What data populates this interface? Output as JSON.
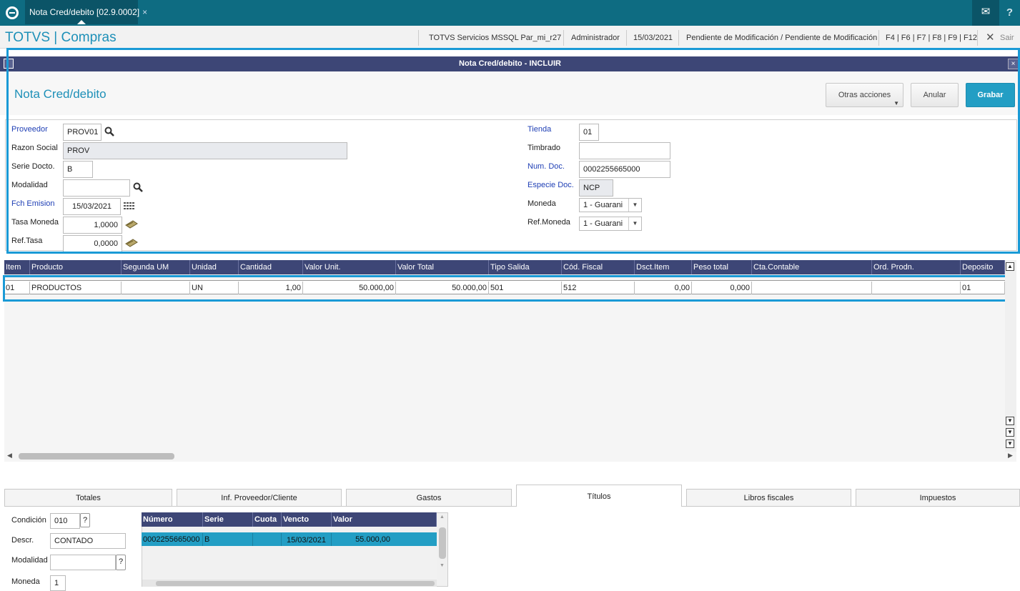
{
  "topbar": {
    "tab_label": "Nota Cred/debito [02.9.0002]",
    "tab_close": "×"
  },
  "appbar": {
    "title": "TOTVS | Compras",
    "service": "TOTVS Servicios MSSQL Par_mi_r27",
    "user": "Administrador",
    "date": "15/03/2021",
    "status": "Pendiente de Modificación / Pendiente de Modificación",
    "shortcuts": "F4 | F6 | F7 | F8 | F9 | F12",
    "exit": "Sair"
  },
  "dialog": {
    "title": "Nota Cred/debito - INCLUIR",
    "close": "×"
  },
  "page": {
    "title": "Nota Cred/debito",
    "btn_other": "Otras acciones",
    "btn_cancel": "Anular",
    "btn_save": "Grabar"
  },
  "form": {
    "proveedor": {
      "label": "Proveedor",
      "value": "PROV01"
    },
    "razon": {
      "label": "Razon Social",
      "value": "PROV"
    },
    "serie": {
      "label": "Serie Docto.",
      "value": "B"
    },
    "modalidad": {
      "label": "Modalidad",
      "value": ""
    },
    "fch": {
      "label": "Fch Emision",
      "value": "15/03/2021"
    },
    "tasa": {
      "label": "Tasa Moneda",
      "value": "1,0000"
    },
    "reftasa": {
      "label": "Ref.Tasa",
      "value": "0,0000"
    },
    "tienda": {
      "label": "Tienda",
      "value": "01"
    },
    "timbrado": {
      "label": "Timbrado",
      "value": ""
    },
    "numdoc": {
      "label": "Num. Doc.",
      "value": "0002255665000"
    },
    "especie": {
      "label": "Especie Doc.",
      "value": "NCP"
    },
    "moneda": {
      "label": "Moneda",
      "value": "1 - Guarani"
    },
    "refmoneda": {
      "label": "Ref.Moneda",
      "value": "1 - Guarani"
    }
  },
  "grid": {
    "columns": [
      "Item",
      "Producto",
      "Segunda UM",
      "Unidad",
      "Cantidad",
      "Valor Unit.",
      "Valor Total",
      "Tipo Salida",
      "Cód. Fiscal",
      "Dsct.Item",
      "Peso total",
      "Cta.Contable",
      "Ord. Prodn.",
      "Deposito"
    ],
    "rows": [
      [
        "01",
        "PRODUCTOS",
        "",
        "UN",
        "1,00",
        "50.000,00",
        "50.000,00",
        "501",
        "512",
        "0,00",
        "0,000",
        "",
        "",
        "01"
      ]
    ]
  },
  "tabs": [
    "Totales",
    "Inf. Proveedor/Cliente",
    "Gastos",
    "Títulos",
    "Libros fiscales",
    "Impuestos"
  ],
  "titulos": {
    "condicion": {
      "label": "Condición",
      "value": "010",
      "help": "?"
    },
    "descr": {
      "label": "Descr.",
      "value": "CONTADO"
    },
    "modalidad": {
      "label": "Modalidad",
      "value": "",
      "help": "?"
    },
    "moneda": {
      "label": "Moneda",
      "value": "1"
    },
    "columns": [
      "Número",
      "Serie",
      "Cuota",
      "Vencto",
      "Valor"
    ],
    "rows": [
      [
        "0002255665000",
        "B",
        "",
        "15/03/2021",
        "55.000,00"
      ]
    ]
  }
}
